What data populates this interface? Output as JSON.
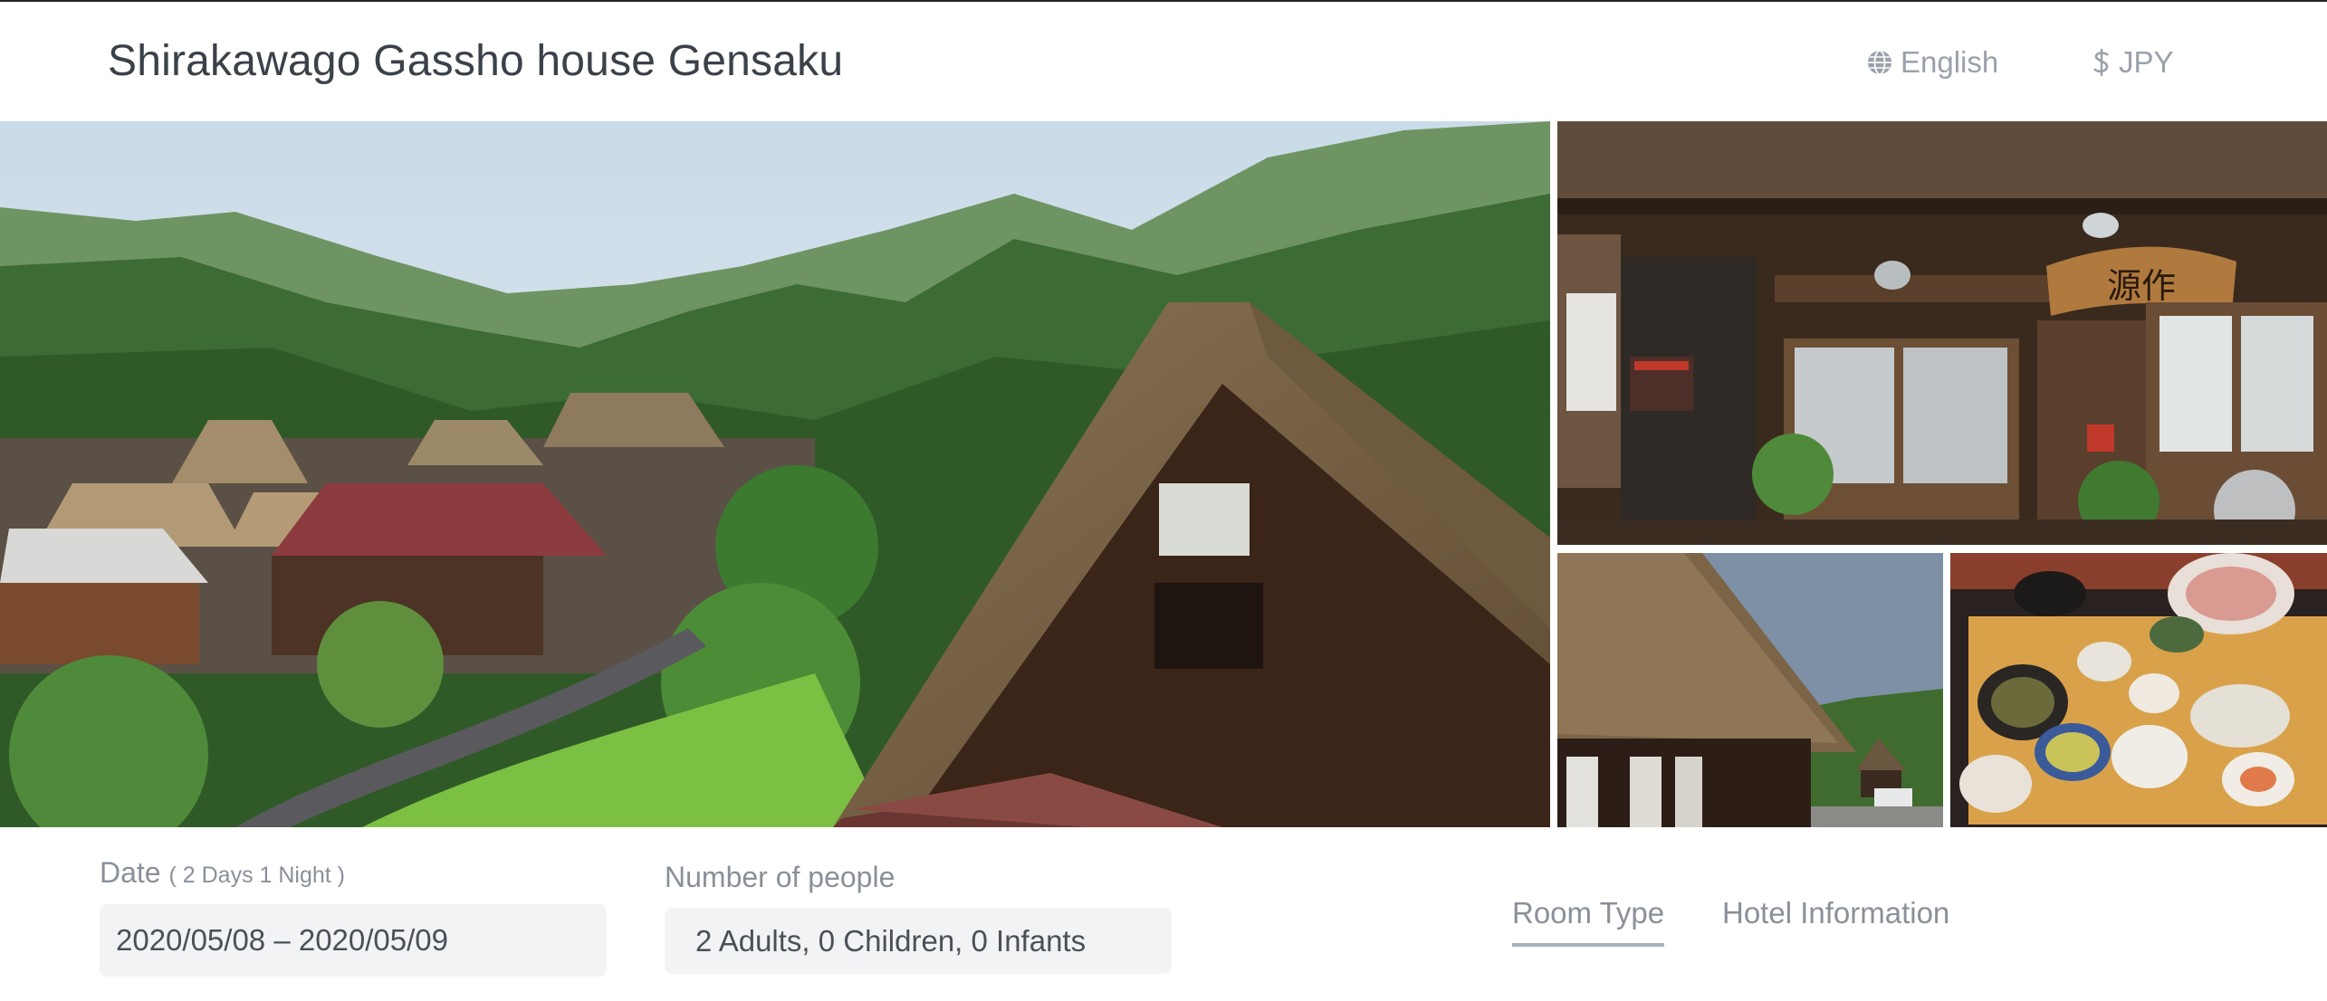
{
  "header": {
    "title": "Shirakawago Gassho house Gensaku",
    "language": {
      "label": "English",
      "icon": "globe-icon"
    },
    "currency": {
      "label": "JPY",
      "icon": "dollar-icon"
    }
  },
  "gallery": {
    "photos": [
      {
        "name": "village-overview-photo"
      },
      {
        "name": "house-entrance-photo",
        "sign_text": "源作"
      },
      {
        "name": "thatched-roof-photo"
      },
      {
        "name": "meal-photo"
      }
    ]
  },
  "booking": {
    "date": {
      "label": "Date",
      "nights": "( 2 Days 1 Night )",
      "value": "2020/05/08 – 2020/05/09"
    },
    "people": {
      "label": "Number of people",
      "value": "2 Adults, 0 Children, 0 Infants"
    }
  },
  "tabs": [
    {
      "label": "Room Type",
      "active": true
    },
    {
      "label": "Hotel Information",
      "active": false
    }
  ],
  "colors": {
    "active_tab_underline": "#a8b1bd",
    "field_bg": "#f2f3f5",
    "muted_text": "#8a9099"
  }
}
